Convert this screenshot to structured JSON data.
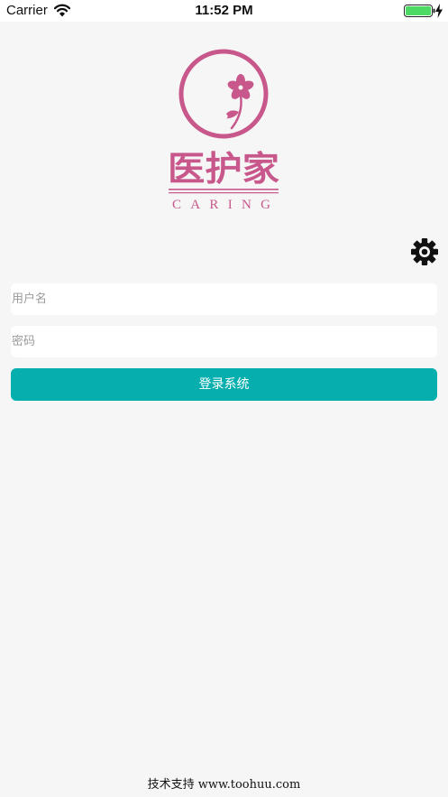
{
  "status_bar": {
    "carrier": "Carrier",
    "time": "11:52 PM"
  },
  "logo": {
    "brand_cn": "医护家",
    "brand_en": "CARING",
    "color": "#c8588c"
  },
  "settings": {
    "icon": "gear-icon"
  },
  "form": {
    "username_placeholder": "用户名",
    "username_value": "",
    "password_placeholder": "密码",
    "password_value": "",
    "login_label": "登录系统"
  },
  "footer": {
    "support_text": "技术支持 www.toohuu.com"
  },
  "colors": {
    "accent": "#06aeae",
    "background": "#f6f6f6",
    "battery": "#4cd964"
  }
}
